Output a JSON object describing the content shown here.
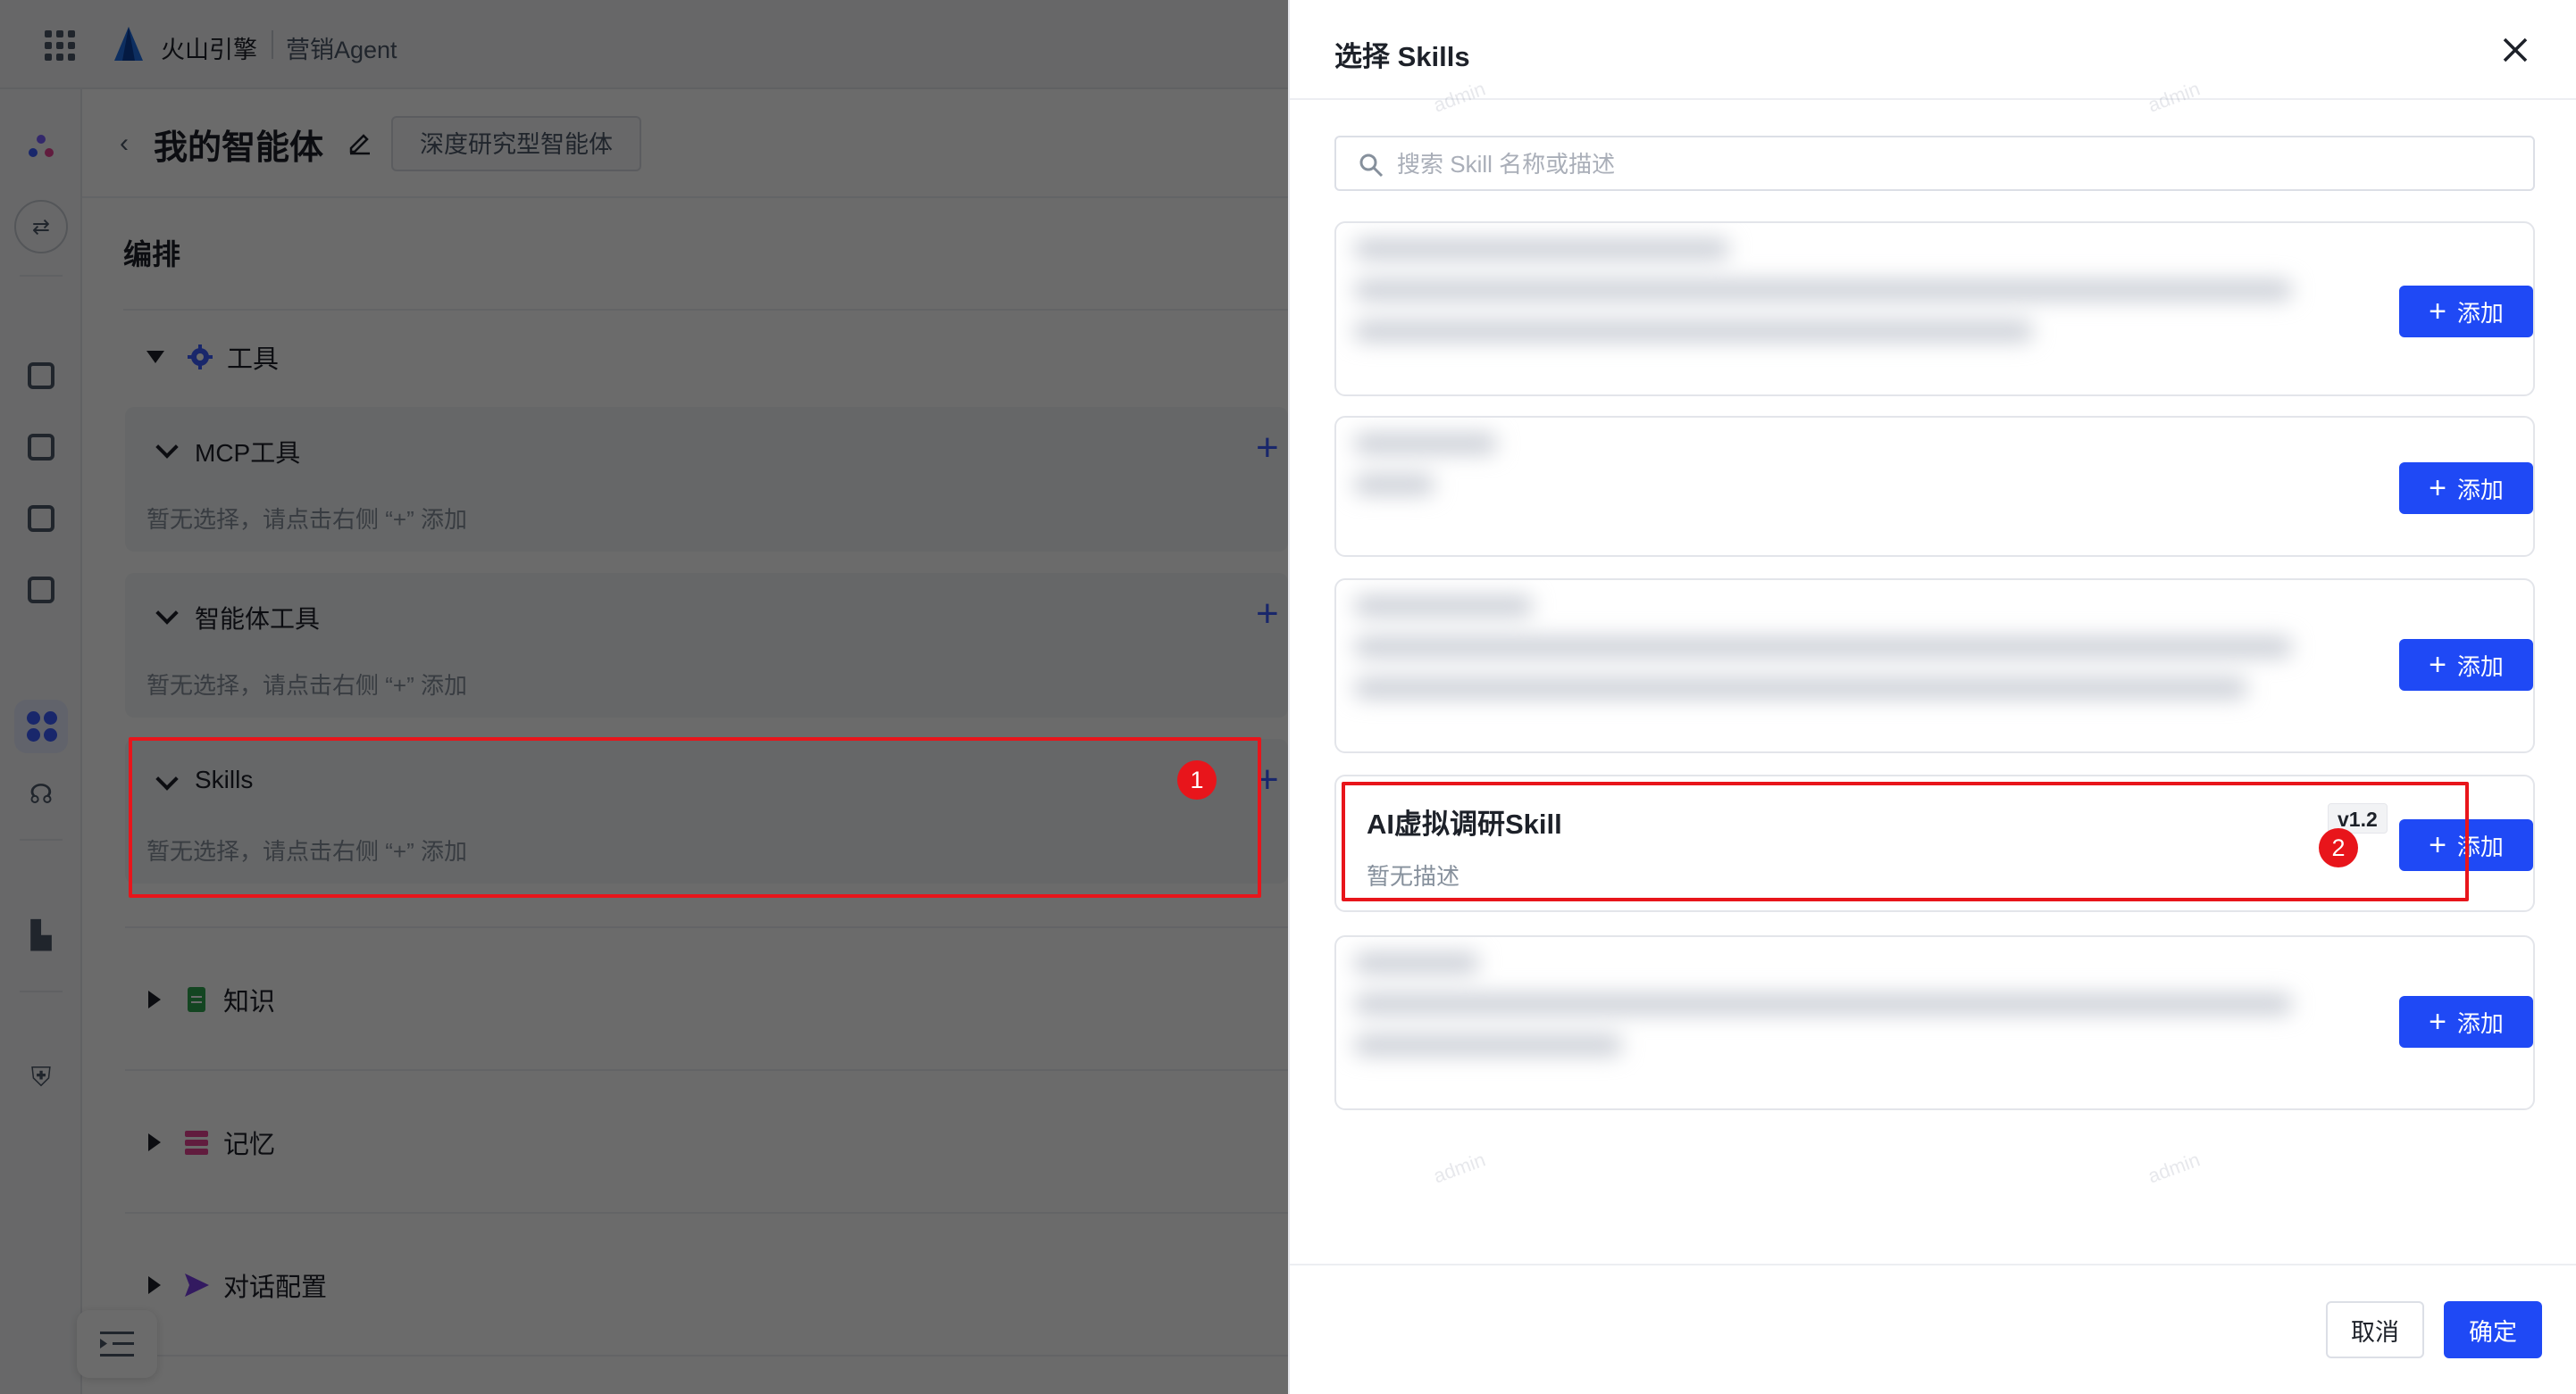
{
  "topbar": {
    "brand_name": "火山引擎",
    "product_name": "营销Agent"
  },
  "page": {
    "title": "我的智能体",
    "agent_type_tag": "深度研究型智能体",
    "section_label": "编排"
  },
  "config": {
    "tools_label": "工具",
    "mcp_tools": {
      "title": "MCP工具",
      "empty_text": "暂无选择，请点击右侧 “+” 添加"
    },
    "agent_tools": {
      "title": "智能体工具",
      "empty_text": "暂无选择，请点击右侧 “+” 添加"
    },
    "skills": {
      "title": "Skills",
      "empty_text": "暂无选择，请点击右侧 “+” 添加"
    },
    "knowledge_label": "知识",
    "memory_label": "记忆",
    "dialog_config_label": "对话配置"
  },
  "annotations": {
    "badge_1": "1",
    "badge_2": "2"
  },
  "drawer": {
    "title": "选择 Skills",
    "search_placeholder": "搜索 Skill 名称或描述",
    "add_label": "添加",
    "highlighted_skill": {
      "name": "AI虚拟调研Skill",
      "version": "v1.2",
      "description": "暂无描述"
    },
    "cancel_label": "取消",
    "confirm_label": "确定"
  },
  "watermark_text": "admin",
  "colors": {
    "accent": "#1f49f5",
    "annotation_red": "#e8151b",
    "text_primary": "#1d2129",
    "text_secondary": "#86909c"
  },
  "icons": {
    "app_grid": "grid-icon",
    "brand": "volcano-logo",
    "back": "chevron-left-icon",
    "edit": "pencil-icon",
    "tools": "gear-icon",
    "knowledge": "document-icon",
    "memory": "stack-icon",
    "dialog": "send-icon",
    "close": "close-icon",
    "search": "search-icon",
    "add": "plus-icon"
  }
}
